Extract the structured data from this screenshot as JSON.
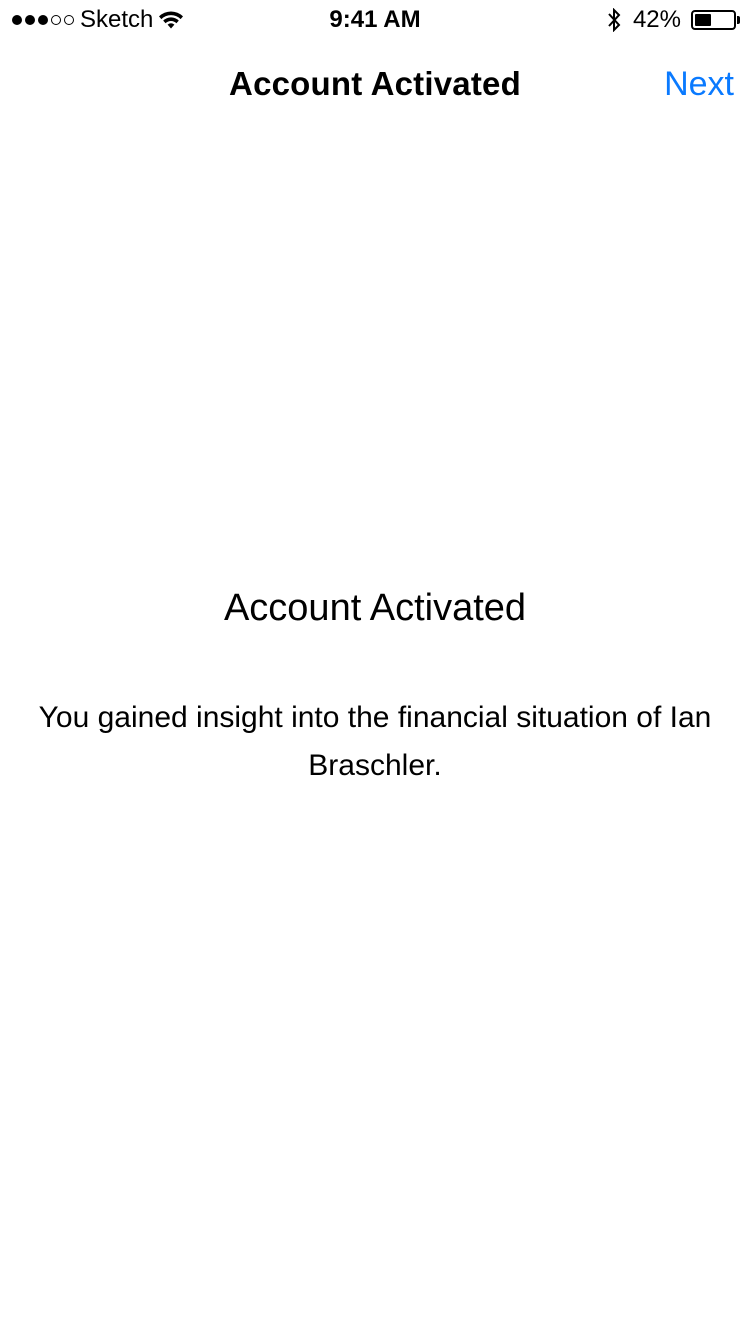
{
  "status_bar": {
    "signal_bars": 5,
    "signal_filled": 3,
    "carrier": "Sketch",
    "wifi_icon": "wifi-icon",
    "time": "9:41 AM",
    "bluetooth_icon": "bluetooth-icon",
    "battery_text": "42%",
    "battery_level": 0.42
  },
  "nav": {
    "title": "Account Activated",
    "next_label": "Next",
    "accent_color": "#0a7aff"
  },
  "main": {
    "heading": "Account Activated",
    "body": "You gained insight into the financial situation of Ian Braschler."
  }
}
